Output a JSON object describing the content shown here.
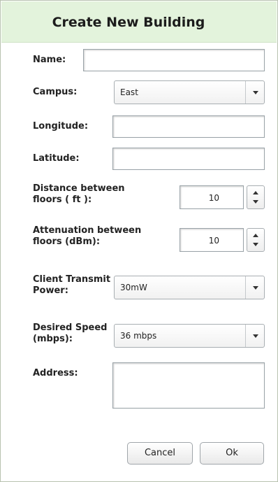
{
  "dialog": {
    "title": "Create New Building"
  },
  "form": {
    "name": {
      "label": "Name:",
      "value": ""
    },
    "campus": {
      "label": "Campus:",
      "value": "East"
    },
    "longitude": {
      "label": "Longitude:",
      "value": ""
    },
    "latitude": {
      "label": "Latitude:",
      "value": ""
    },
    "distance": {
      "label_line1": "Distance between",
      "label_line2": "floors ( ft ):",
      "value": "10"
    },
    "attenuation": {
      "label_line1": "Attenuation between",
      "label_line2": "floors (dBm):",
      "value": "10"
    },
    "power": {
      "label_line1": "Client Transmit",
      "label_line2": "Power:",
      "value": "30mW"
    },
    "speed": {
      "label_line1": "Desired Speed",
      "label_line2": "(mbps):",
      "value": "36 mbps"
    },
    "address": {
      "label": "Address:",
      "value": ""
    }
  },
  "buttons": {
    "cancel": "Cancel",
    "ok": "Ok"
  },
  "icons": {
    "dropdown": "chevron-down-icon",
    "spin_up": "arrow-up-icon",
    "spin_down": "arrow-down-icon"
  }
}
